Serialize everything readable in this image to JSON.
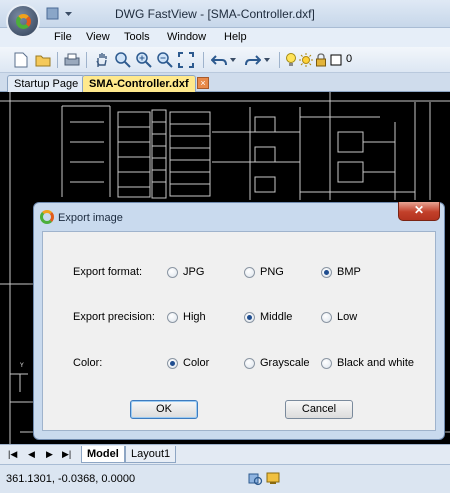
{
  "window": {
    "title": "DWG FastView - [SMA-Controller.dxf]"
  },
  "menu": [
    "File",
    "View",
    "Tools",
    "Window",
    "Help"
  ],
  "toolbar": {
    "layer_count": "0"
  },
  "tabs": [
    {
      "label": "Startup Page"
    },
    {
      "label": "SMA-Controller.dxf"
    }
  ],
  "layout_tabs": [
    "Model",
    "Layout1"
  ],
  "status": {
    "coords": "361.1301, -0.0368, 0.0000"
  },
  "dialog": {
    "title": "Export image",
    "rows": [
      {
        "label": "Export format:",
        "options": [
          "JPG",
          "PNG",
          "BMP"
        ],
        "selected": 2
      },
      {
        "label": "Export precision:",
        "options": [
          "High",
          "Middle",
          "Low"
        ],
        "selected": 1
      },
      {
        "label": "Color:",
        "options": [
          "Color",
          "Grayscale",
          "Black and white"
        ],
        "selected": 0
      }
    ],
    "ok_label": "OK",
    "cancel_label": "Cancel"
  }
}
